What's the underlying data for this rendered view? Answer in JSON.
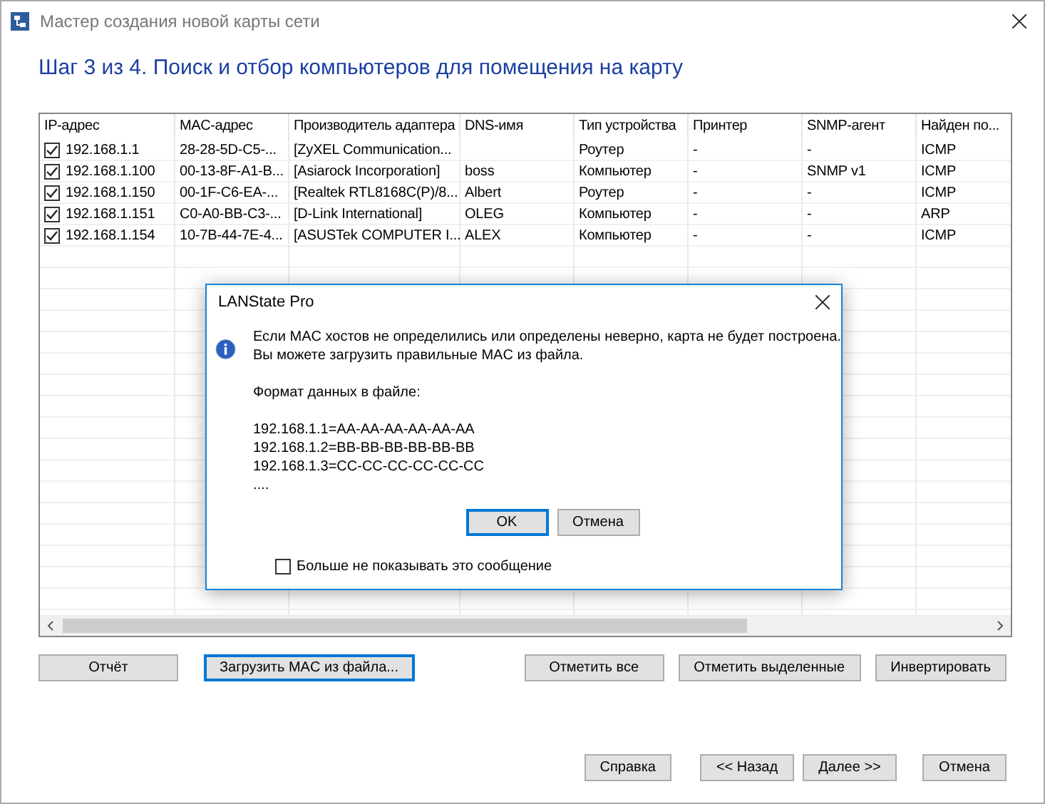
{
  "window": {
    "title": "Мастер создания новой карты сети"
  },
  "heading": "Шаг 3 из 4. Поиск и отбор компьютеров для помещения на карту",
  "table": {
    "columns": [
      "IP-адрес",
      "MAC-адрес",
      "Производитель адаптера",
      "DNS-имя",
      "Тип устройства",
      "Принтер",
      "SNMP-агент",
      "Найден по..."
    ],
    "rows": [
      {
        "checked": true,
        "cells": [
          "192.168.1.1",
          "28-28-5D-C5-...",
          "[ZyXEL Communication...",
          null,
          "Роутер",
          "-",
          "-",
          "ICMP"
        ]
      },
      {
        "checked": true,
        "cells": [
          "192.168.1.100",
          "00-13-8F-A1-B...",
          "[Asiarock Incorporation]",
          "boss",
          "Компьютер",
          "-",
          "SNMP v1",
          "ICMP"
        ]
      },
      {
        "checked": true,
        "cells": [
          "192.168.1.150",
          "00-1F-C6-EA-...",
          "[Realtek RTL8168C(P)/8...",
          "Albert",
          "Роутер",
          "-",
          "-",
          "ICMP"
        ]
      },
      {
        "checked": true,
        "cells": [
          "192.168.1.151",
          "C0-A0-BB-C3-...",
          "[D-Link International]",
          "OLEG",
          "Компьютер",
          "-",
          "-",
          "ARP"
        ]
      },
      {
        "checked": true,
        "cells": [
          "192.168.1.154",
          "10-7B-44-7E-4...",
          "[ASUSTek COMPUTER I...",
          "ALEX",
          "Компьютер",
          "-",
          "-",
          "ICMP"
        ]
      }
    ]
  },
  "left_buttons": [
    {
      "label": "Отчёт",
      "focused": false
    },
    {
      "label": "Загрузить MAC из файла...",
      "focused": true
    }
  ],
  "right_buttons": [
    {
      "label": "Отметить все",
      "focused": false
    },
    {
      "label": "Отметить выделенные",
      "focused": false
    },
    {
      "label": "Инвертировать",
      "focused": false
    }
  ],
  "nav_buttons": [
    {
      "label": "Справка",
      "focused": false
    },
    {
      "label": "<< Назад",
      "focused": false
    },
    {
      "label": "Далее >>",
      "focused": false
    },
    {
      "label": "Отмена",
      "focused": false
    }
  ],
  "dialog": {
    "title": "LANState Pro",
    "message": "Если MAC хостов не определились или определены неверно, карта не будет построена.\nВы можете загрузить правильные MAC из файла.",
    "format_label": "Формат данных в файле:",
    "format_lines": [
      "192.168.1.1=AA-AA-AA-AA-AA-AA",
      "192.168.1.2=BB-BB-BB-BB-BB-BB",
      "192.168.1.3=CC-CC-CC-CC-CC-CC",
      "...."
    ],
    "buttons": [
      {
        "label": "OK",
        "focused": true
      },
      {
        "label": "Отмена",
        "focused": false
      }
    ],
    "checkbox": {
      "label": "Больше не показывать это сообщение",
      "checked": false
    }
  }
}
